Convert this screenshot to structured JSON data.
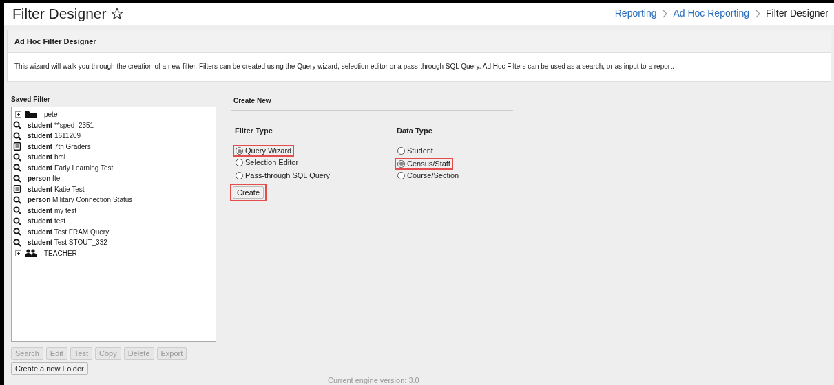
{
  "page": {
    "title": "Filter Designer",
    "favorite": false
  },
  "breadcrumb": [
    {
      "label": "Reporting",
      "link": true
    },
    {
      "label": "Ad Hoc Reporting",
      "link": true
    },
    {
      "label": "Filter Designer",
      "link": false
    }
  ],
  "panel": {
    "title": "Ad Hoc Filter Designer",
    "description": "This wizard will walk you through the creation of a new filter. Filters can be created using the Query wizard, selection editor or a pass-through SQL Query. Ad Hoc Filters can be used as a search, or as input to a report."
  },
  "saved_filter": {
    "title": "Saved Filter",
    "items": [
      {
        "kind": "folder",
        "name": "pete",
        "expanded": false
      },
      {
        "kind": "query",
        "type": "student",
        "name": "**sped_2351"
      },
      {
        "kind": "query",
        "type": "student",
        "name": "1611209"
      },
      {
        "kind": "report",
        "type": "student",
        "name": "7th Graders"
      },
      {
        "kind": "query",
        "type": "student",
        "name": "bmi"
      },
      {
        "kind": "query",
        "type": "student",
        "name": "Early Learning Test"
      },
      {
        "kind": "query",
        "type": "person",
        "name": "fte"
      },
      {
        "kind": "report",
        "type": "student",
        "name": "Katie Test"
      },
      {
        "kind": "query",
        "type": "person",
        "name": "Military Connection Status"
      },
      {
        "kind": "query",
        "type": "student",
        "name": "my test"
      },
      {
        "kind": "query",
        "type": "student",
        "name": "test"
      },
      {
        "kind": "query",
        "type": "student",
        "name": "Test FRAM Query"
      },
      {
        "kind": "query",
        "type": "student",
        "name": "Test STOUT_332"
      },
      {
        "kind": "group",
        "name": "TEACHER",
        "expanded": false
      }
    ],
    "buttons": [
      {
        "label": "Search",
        "disabled": true
      },
      {
        "label": "Edit",
        "disabled": true
      },
      {
        "label": "Test",
        "disabled": true
      },
      {
        "label": "Copy",
        "disabled": true
      },
      {
        "label": "Delete",
        "disabled": true
      },
      {
        "label": "Export",
        "disabled": true
      }
    ],
    "folder_button": {
      "label": "Create a new Folder",
      "disabled": false
    }
  },
  "create_new": {
    "title": "Create New",
    "filter_type": {
      "label": "Filter Type",
      "options": [
        {
          "label": "Query Wizard",
          "selected": true,
          "highlighted": true
        },
        {
          "label": "Selection Editor",
          "selected": false,
          "highlighted": false
        },
        {
          "label": "Pass-through SQL Query",
          "selected": false,
          "highlighted": false
        }
      ]
    },
    "data_type": {
      "label": "Data Type",
      "options": [
        {
          "label": "Student",
          "selected": false,
          "highlighted": false
        },
        {
          "label": "Census/Staff",
          "selected": true,
          "highlighted": true
        },
        {
          "label": "Course/Section",
          "selected": false,
          "highlighted": false
        }
      ]
    },
    "create_button": {
      "label": "Create",
      "highlighted": true
    }
  },
  "footer": {
    "text": "Current engine version: 3.0"
  }
}
